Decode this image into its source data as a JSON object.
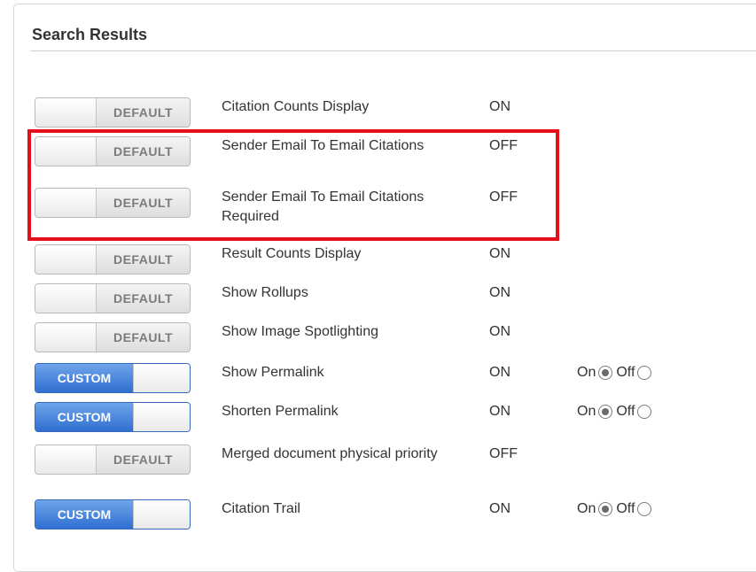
{
  "section": {
    "title": "Search Results"
  },
  "settings": [
    {
      "toggle": "DEFAULT",
      "mode": "default",
      "name": "Citation Counts Display",
      "value": "ON"
    },
    {
      "toggle": "DEFAULT",
      "mode": "default",
      "name": "Sender Email To Email Citations",
      "value": "OFF"
    },
    {
      "toggle": "DEFAULT",
      "mode": "default",
      "name": "Sender Email To Email Citations Required",
      "value": "OFF"
    },
    {
      "toggle": "DEFAULT",
      "mode": "default",
      "name": "Result Counts Display",
      "value": "ON"
    },
    {
      "toggle": "DEFAULT",
      "mode": "default",
      "name": "Show Rollups",
      "value": "ON"
    },
    {
      "toggle": "DEFAULT",
      "mode": "default",
      "name": "Show Image Spotlighting",
      "value": "ON"
    },
    {
      "toggle": "CUSTOM",
      "mode": "custom",
      "name": "Show Permalink",
      "value": "ON",
      "radio": {
        "on_label": "On",
        "off_label": "Off",
        "selected": "on"
      }
    },
    {
      "toggle": "CUSTOM",
      "mode": "custom",
      "name": "Shorten Permalink",
      "value": "ON",
      "radio": {
        "on_label": "On",
        "off_label": "Off",
        "selected": "on"
      }
    },
    {
      "toggle": "DEFAULT",
      "mode": "default",
      "name": "Merged document physical priority",
      "value": "OFF"
    },
    {
      "toggle": "CUSTOM",
      "mode": "custom",
      "name": "Citation Trail",
      "value": "ON",
      "radio": {
        "on_label": "On",
        "off_label": "Off",
        "selected": "on"
      }
    }
  ],
  "colors": {
    "highlight": "#e3101b",
    "custom_toggle": "#2f6fd1"
  }
}
